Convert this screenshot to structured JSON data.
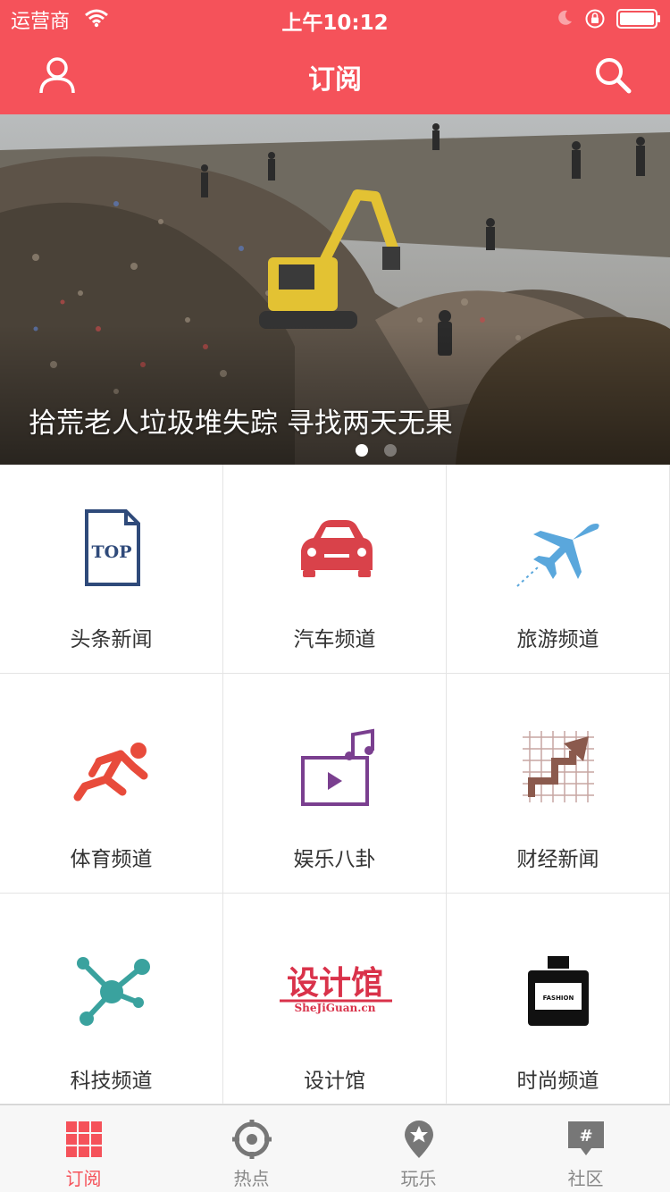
{
  "status_bar": {
    "carrier": "运营商",
    "time": "上午10:12"
  },
  "nav": {
    "title": "订阅",
    "left_icon": "user-icon",
    "right_icon": "search-icon"
  },
  "banner": {
    "caption": "拾荒老人垃圾堆失踪 寻找两天无果",
    "page_count": 2,
    "active_page": 1
  },
  "channels": [
    {
      "label": "头条新闻",
      "icon": "top-news-icon"
    },
    {
      "label": "汽车频道",
      "icon": "car-icon"
    },
    {
      "label": "旅游频道",
      "icon": "airplane-icon"
    },
    {
      "label": "体育频道",
      "icon": "runner-icon"
    },
    {
      "label": "娱乐八卦",
      "icon": "video-music-icon"
    },
    {
      "label": "财经新闻",
      "icon": "finance-chart-icon"
    },
    {
      "label": "科技频道",
      "icon": "network-icon"
    },
    {
      "label": "设计馆",
      "icon": "sheji-logo-icon",
      "logo_text": "设计馆",
      "logo_subtext": "SheJiGuan.cn"
    },
    {
      "label": "时尚频道",
      "icon": "perfume-icon",
      "logo_text": "FASHION"
    }
  ],
  "tabs": [
    {
      "label": "订阅",
      "icon": "grid-icon",
      "active": true
    },
    {
      "label": "热点",
      "icon": "target-icon",
      "active": false
    },
    {
      "label": "玩乐",
      "icon": "star-pin-icon",
      "active": false
    },
    {
      "label": "社区",
      "icon": "hash-bubble-icon",
      "active": false
    }
  ],
  "colors": {
    "accent": "#f5525a",
    "tab_inactive": "#888888",
    "icon_gray": "#777777"
  }
}
